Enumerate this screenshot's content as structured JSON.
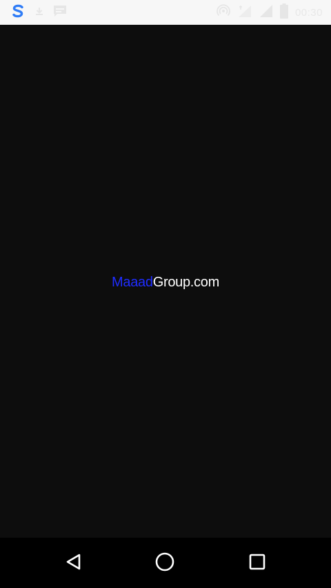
{
  "status_bar": {
    "time": "00:30",
    "left_icons": [
      "swiftkey-s-icon",
      "download-icon",
      "message-icon"
    ],
    "right_icons": [
      "hotspot-icon",
      "signal-strength-icon",
      "cell-signal-icon",
      "battery-icon"
    ],
    "accent_color": "#2f7cf6"
  },
  "splash": {
    "brand_part1": "Maaad",
    "brand_part2": "Group.com",
    "brand_color_1": "#1f2dff",
    "brand_color_2": "#ffffff",
    "background": "#0d0d0d"
  },
  "nav_bar": {
    "buttons": [
      "back-icon",
      "home-icon",
      "recent-apps-icon"
    ]
  }
}
